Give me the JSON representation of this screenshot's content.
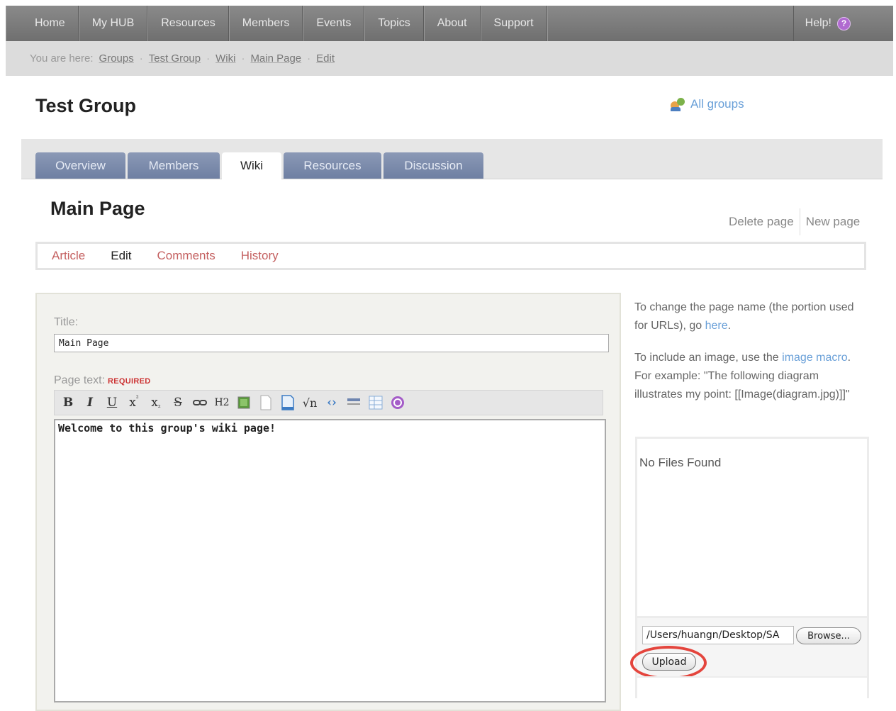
{
  "topnav": {
    "items": [
      "Home",
      "My HUB",
      "Resources",
      "Members",
      "Events",
      "Topics",
      "About",
      "Support"
    ],
    "help_label": "Help!"
  },
  "breadcrumb": {
    "lead": "You are here:",
    "items": [
      "Groups",
      "Test Group",
      "Wiki",
      "Main Page",
      "Edit"
    ]
  },
  "group": {
    "title": "Test Group",
    "all_groups_label": "All groups"
  },
  "tabs": [
    {
      "label": "Overview",
      "active": false
    },
    {
      "label": "Members",
      "active": false
    },
    {
      "label": "Wiki",
      "active": true
    },
    {
      "label": "Resources",
      "active": false
    },
    {
      "label": "Discussion",
      "active": false
    }
  ],
  "page": {
    "title": "Main Page",
    "delete_label": "Delete page",
    "new_label": "New page"
  },
  "subtabs": [
    {
      "label": "Article",
      "current": false
    },
    {
      "label": "Edit",
      "current": true
    },
    {
      "label": "Comments",
      "current": false
    },
    {
      "label": "History",
      "current": false
    }
  ],
  "form": {
    "title_label": "Title:",
    "title_value": "Main Page",
    "page_text_label": "Page text:",
    "required_label": "REQUIRED",
    "body_text": "Welcome to this group's wiki page!",
    "toolbar_icons": [
      "bold-icon",
      "italic-icon",
      "underline-icon",
      "superscript-icon",
      "subscript-icon",
      "strikethrough-icon",
      "link-icon",
      "heading-icon",
      "image-icon",
      "file-icon",
      "document-icon",
      "math-icon",
      "code-icon",
      "horizontal-rule-icon",
      "table-icon",
      "help-icon"
    ],
    "toolbar_glyphs": {
      "bold": "B",
      "italic": "I",
      "underline": "U",
      "superscript": "x",
      "superscript_mark": "²",
      "subscript": "x",
      "subscript_mark": "₂",
      "strike": "S",
      "heading": "H2",
      "math": "√n",
      "code": "‹›"
    }
  },
  "sidebar": {
    "rename_text_1": "To change the page name (the portion used for URLs), go ",
    "rename_link": "here",
    "rename_text_2": ".",
    "image_text_1": "To include an image, use the ",
    "image_link": "image macro",
    "image_text_2": ". For example: \"The following diagram illustrates my point: [[Image(diagram.jpg)]]\"",
    "no_files": "No Files Found",
    "file_path": "/Users/huangn/Desktop/SA",
    "browse_label": "Browse...",
    "upload_label": "Upload"
  },
  "colors": {
    "nav_bg": "#7c7c7c",
    "tab_bg": "#7c8bad",
    "link": "#6aa0d8",
    "subtab_link": "#c46060",
    "required": "#cc3333",
    "highlight_ring": "#e4453d"
  }
}
